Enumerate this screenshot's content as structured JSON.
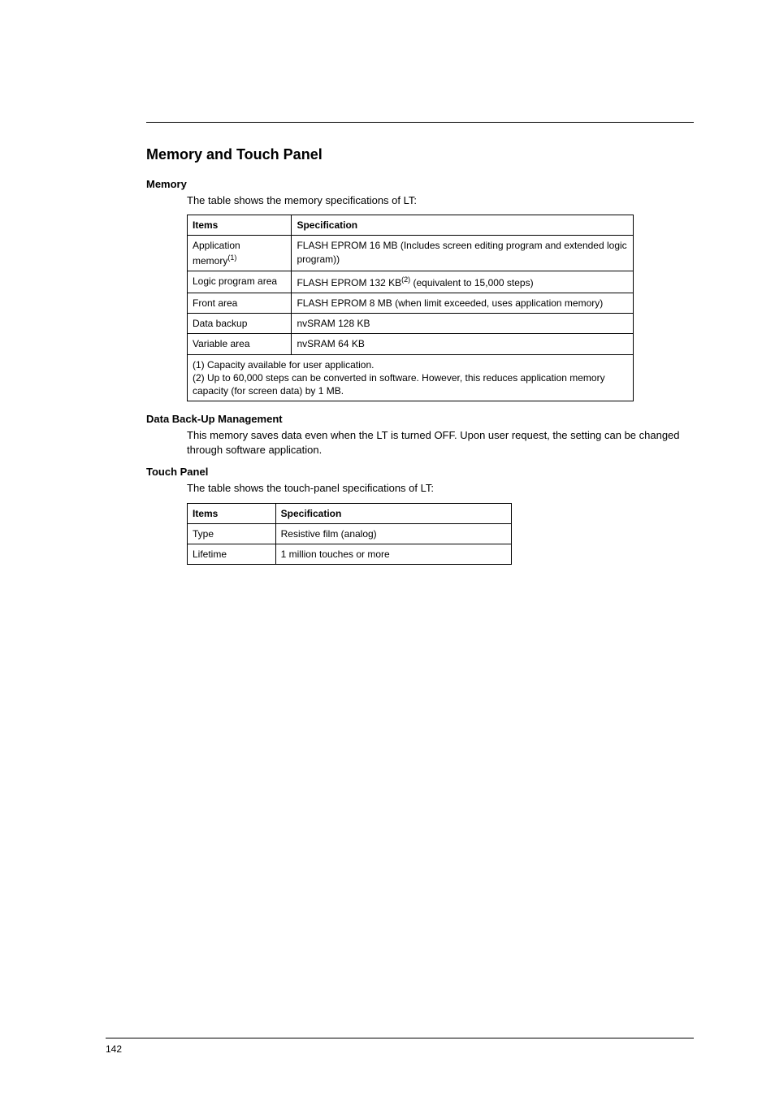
{
  "section_title": "Memory and Touch Panel",
  "memory": {
    "heading": "Memory",
    "intro": "The table shows the memory specifications of LT:",
    "header_items": "Items",
    "header_spec": "Specification",
    "rows": [
      {
        "item_pre": "Application memory",
        "item_sup": "(1)",
        "spec": "FLASH EPROM 16 MB (Includes screen editing program and extended logic program))"
      },
      {
        "item": "Logic program area",
        "spec_pre": "FLASH EPROM 132 KB",
        "spec_sup": "(2)",
        "spec_post": " (equivalent to 15,000 steps)"
      },
      {
        "item": "Front area",
        "spec": "FLASH EPROM 8 MB (when limit exceeded, uses application memory)"
      },
      {
        "item": "Data backup",
        "spec": "nvSRAM 128 KB"
      },
      {
        "item": "Variable area",
        "spec": "nvSRAM 64 KB"
      }
    ],
    "footnote": "(1) Capacity available for user application.\n(2) Up to 60,000 steps can be converted in software. However, this reduces application memory capacity (for screen data) by 1 MB."
  },
  "backup": {
    "heading": "Data Back-Up Management",
    "text": "This memory saves data even when the LT is turned OFF. Upon user request, the setting can be changed through software application."
  },
  "touch": {
    "heading": "Touch Panel",
    "intro": "The table shows the touch-panel specifications of LT:",
    "header_items": "Items",
    "header_spec": "Specification",
    "rows": [
      {
        "item": "Type",
        "spec": "Resistive film (analog)"
      },
      {
        "item": "Lifetime",
        "spec": "1 million touches or more"
      }
    ]
  },
  "page_number": "142"
}
